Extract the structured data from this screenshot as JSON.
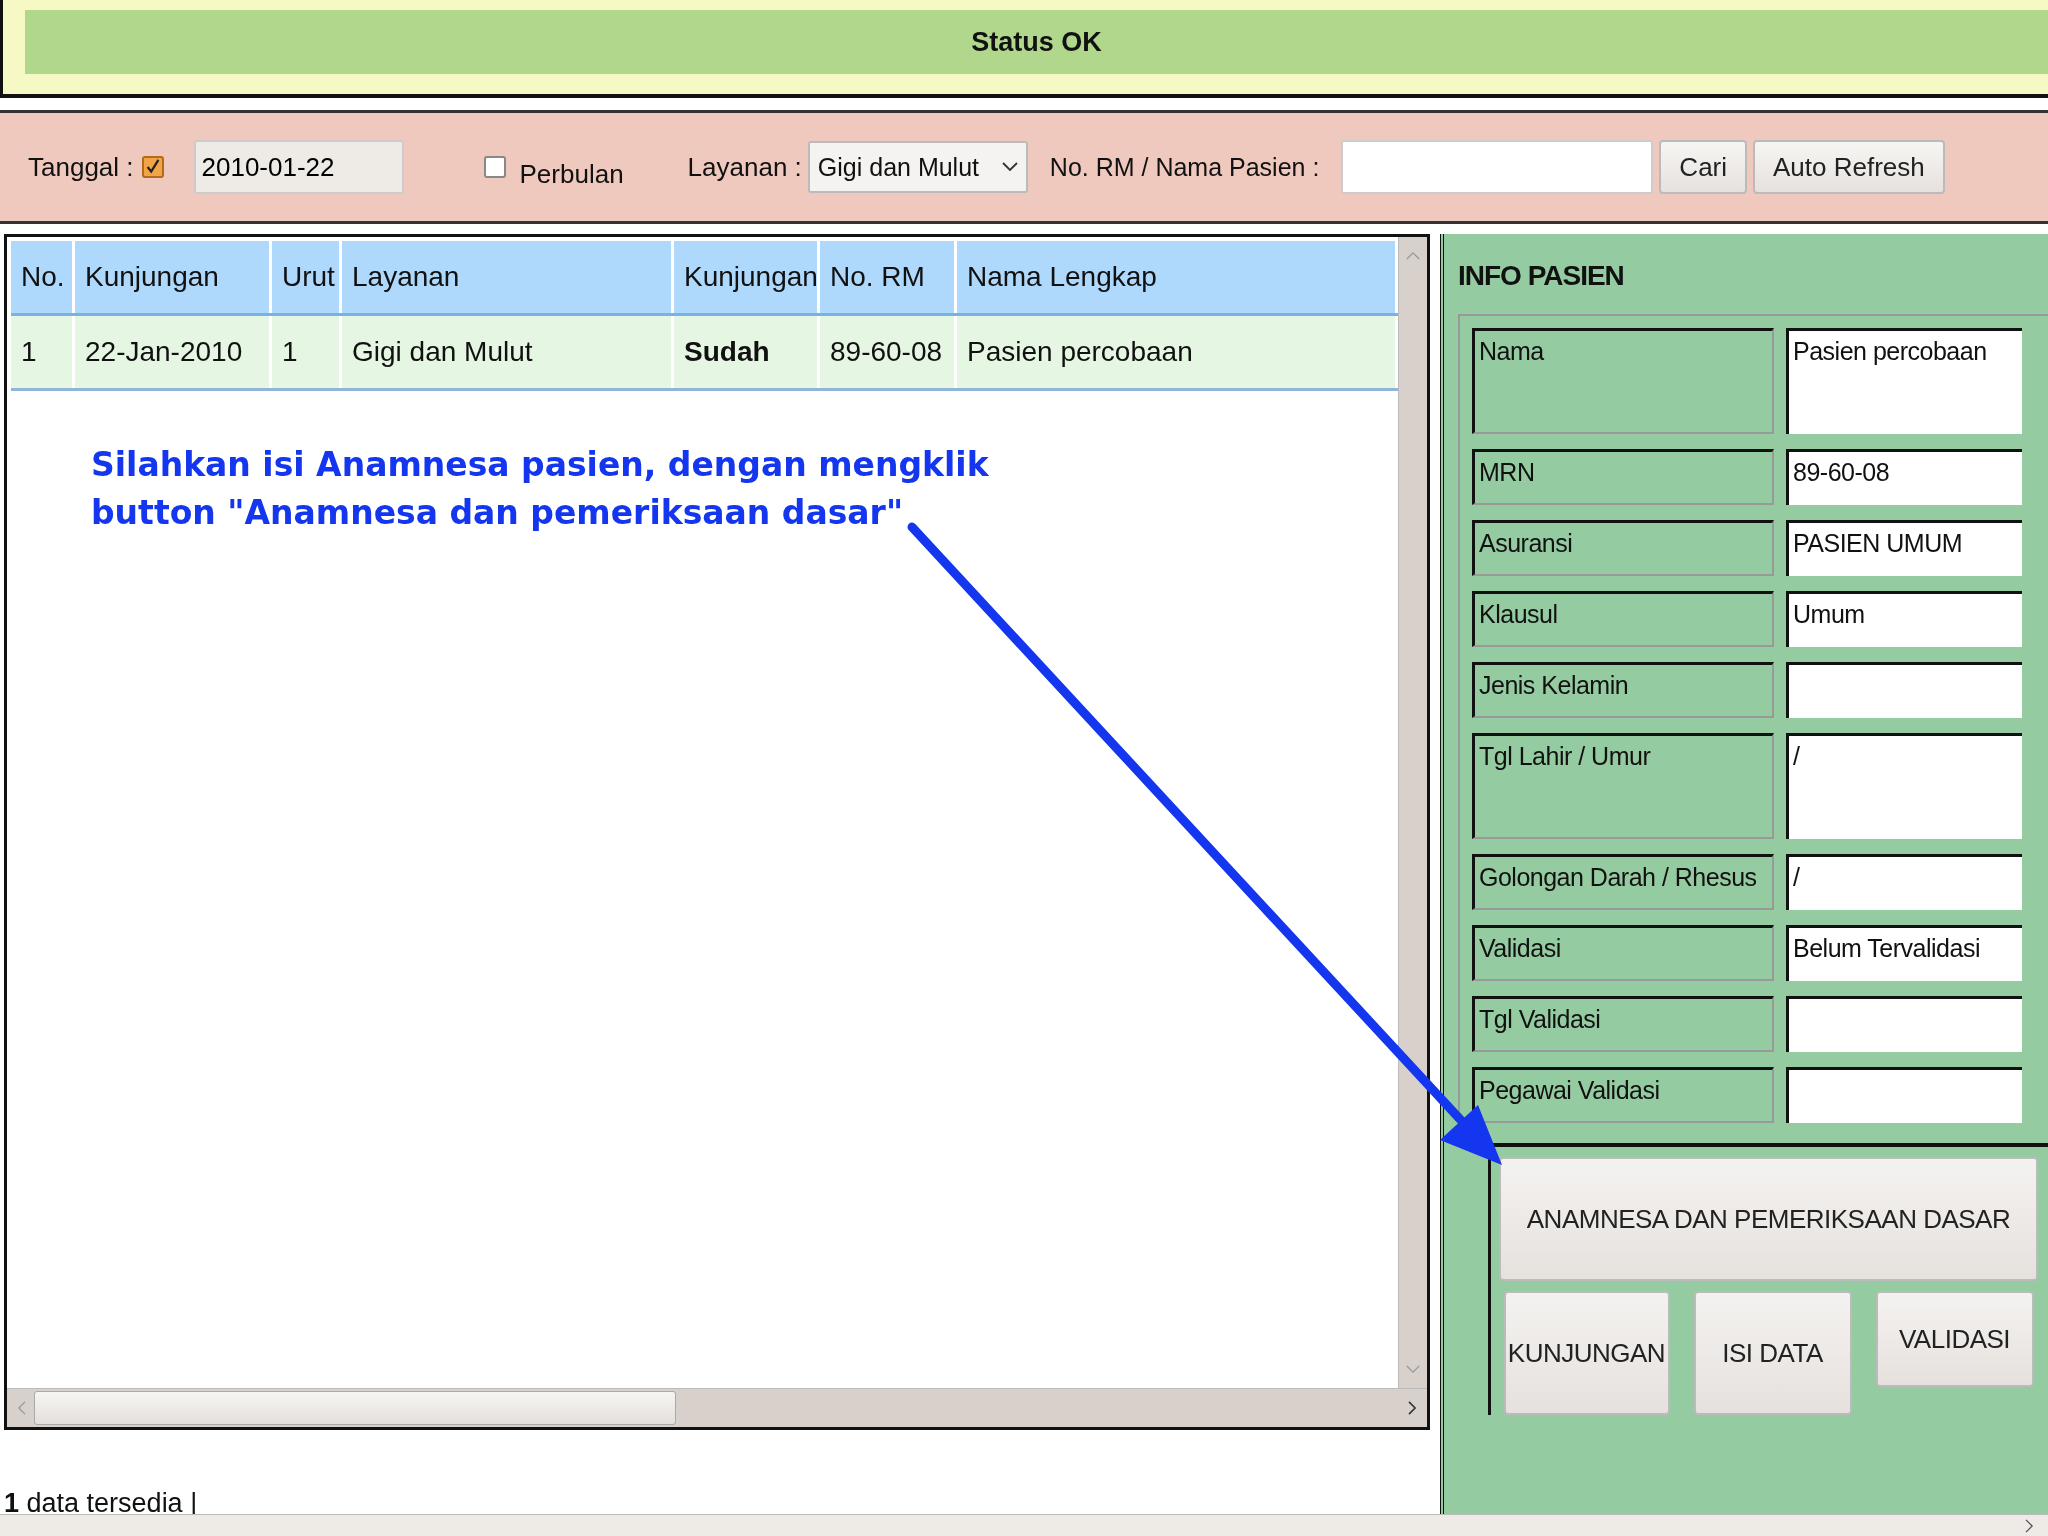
{
  "status": {
    "text": "Status OK"
  },
  "toolbar": {
    "tanggal": {
      "label": "Tanggal :",
      "checked": true
    },
    "date": {
      "value": "2010-01-22"
    },
    "perbulan": {
      "label": "Perbulan",
      "checked": false
    },
    "layanan": {
      "label": "Layanan :",
      "value": "Gigi dan Mulut"
    },
    "search": {
      "label": "No. RM / Nama Pasien :"
    },
    "buttons": [
      "Cari",
      "Auto Refresh"
    ]
  },
  "table": {
    "columns": [
      "No.",
      "Kunjungan",
      "Urut",
      "Layanan",
      "Kunjungan",
      "No. RM",
      "Nama Lengkap"
    ],
    "rows": [
      [
        "1",
        "22-Jan-2010",
        "1",
        "Gigi dan Mulut",
        "Sudah",
        "89-60-08",
        "Pasien percobaan"
      ]
    ]
  },
  "annotation": {
    "lines": [
      "Silahkan isi Anamnesa pasien, dengan mengklik",
      "button \"Anamnesa dan pemeriksaan dasar\""
    ]
  },
  "info": {
    "title": "INFO PASIEN",
    "rows": [
      {
        "label": "Nama",
        "value": "Pasien percobaan",
        "kind": "tall"
      },
      {
        "label": "MRN",
        "value": "89-60-08",
        "kind": "short"
      },
      {
        "label": "Asuransi",
        "value": "PASIEN UMUM",
        "kind": "short"
      },
      {
        "label": "Klausul",
        "value": "Umum",
        "kind": "short"
      },
      {
        "label": "Jenis Kelamin",
        "value": "",
        "kind": "short"
      },
      {
        "label": "Tgl Lahir / Umur",
        "value": "/",
        "kind": "tall"
      },
      {
        "label": "Golongan Darah / Rhesus",
        "value": "/",
        "kind": "short"
      },
      {
        "label": "Validasi",
        "value": "Belum Tervalidasi",
        "kind": "short"
      },
      {
        "label": "Tgl Validasi",
        "value": "",
        "kind": "short"
      },
      {
        "label": "Pegawai Validasi",
        "value": "",
        "kind": "short"
      }
    ],
    "buttons": [
      {
        "label": "ANAMNESA DAN PEMERIKSAAN DASAR",
        "kind": "wide"
      },
      {
        "label": "KUNJUNGAN",
        "kind": "normal"
      },
      {
        "label": "ISI DATA",
        "kind": "normal"
      },
      {
        "label": "VALIDASI",
        "kind": "normal"
      }
    ]
  },
  "footer": {
    "text": "**1** data tersedia |"
  }
}
